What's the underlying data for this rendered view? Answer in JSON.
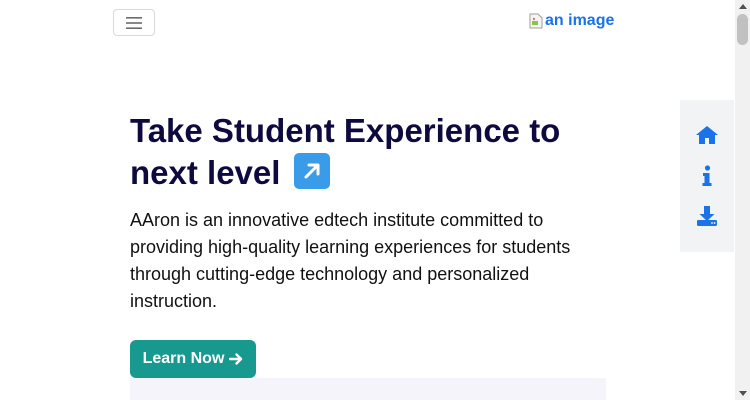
{
  "navbar": {
    "toggle_icon": "hamburger-menu-icon",
    "brand_alt": "an image",
    "brand_color": "#1a73e8"
  },
  "hero": {
    "title": "Take Student Experience to next level",
    "title_emoji_icon": "arrow-up-right-icon",
    "description": "AAron is an innovative edtech institute committed to providing high-quality learning experiences for students through cutting-edge technology and personalized instruction.",
    "cta_label": "Learn Now",
    "cta_icon": "arrow-right-icon",
    "cta_color": "#17998f",
    "title_color": "#0d0a3f"
  },
  "side_rail": {
    "items": [
      {
        "icon": "home-icon"
      },
      {
        "icon": "info-icon"
      },
      {
        "icon": "download-icon"
      }
    ],
    "icon_color": "#1a73e8"
  }
}
